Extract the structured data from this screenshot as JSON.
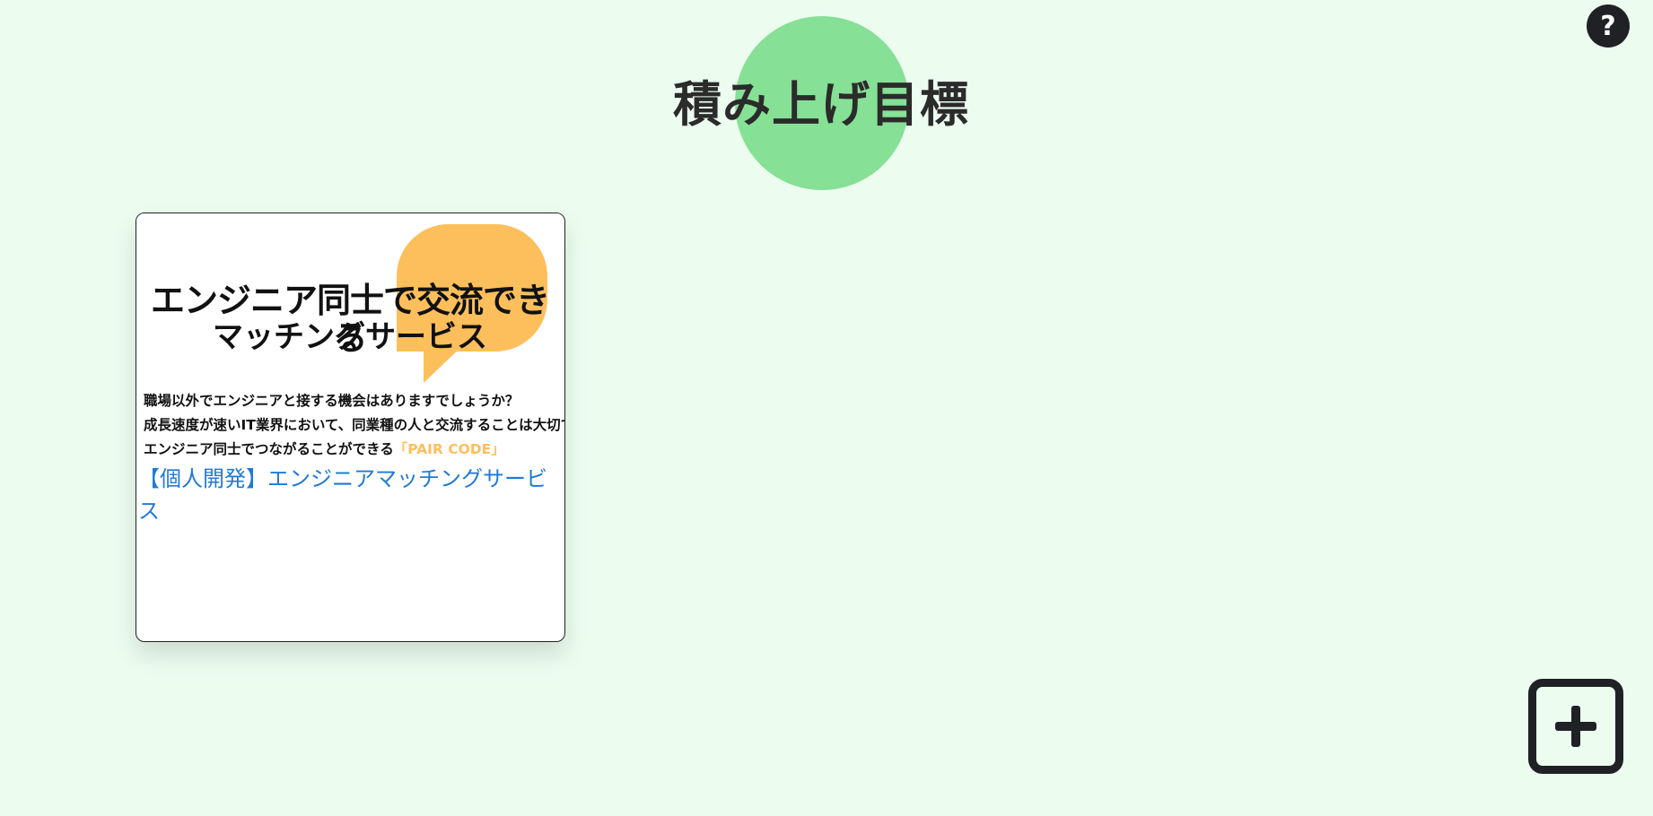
{
  "header": {
    "title": "積み上げ目標",
    "help_label": "?"
  },
  "cards": [
    {
      "thumbnail": {
        "headline": "エンジニア同士で交流できる",
        "subheadline": "マッチングサービス",
        "lines": [
          "職場以外でエンジニアと接する機会はありますでしょうか？",
          "成長速度が速いIT業界において、同業種の人と交流することは大切です",
          "エンジニア同士でつながることができる"
        ],
        "brand": "「PAIR CODE」"
      },
      "link_text": "【個人開発】エンジニアマッチングサービス"
    }
  ],
  "colors": {
    "background": "#ecfdf0",
    "title_circle": "#86e096",
    "bubble": "#fdbf5c",
    "link": "#1f7ad6",
    "dark": "#1f2124"
  },
  "icons": {
    "help": "question-circle-icon",
    "add": "plus-square-icon"
  }
}
